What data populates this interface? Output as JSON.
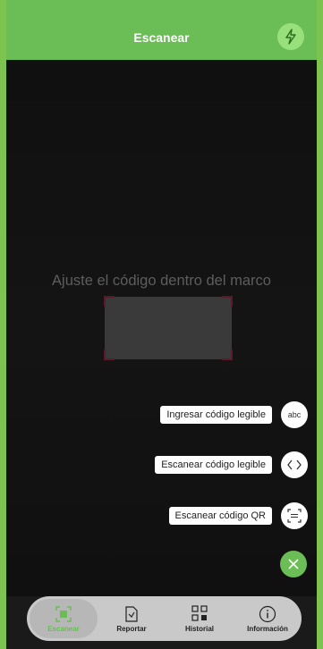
{
  "header": {
    "title": "Escanear",
    "flash_icon": "flash-icon"
  },
  "camera": {
    "hint": "Ajuste el código dentro del marco"
  },
  "actions": [
    {
      "label": "Ingresar código legible",
      "icon": "abc",
      "icon_name": "text-input-icon"
    },
    {
      "label": "Escanear código legible",
      "icon": "<>",
      "icon_name": "code-brackets-icon"
    },
    {
      "label": "Escanear código QR",
      "icon": "qr",
      "icon_name": "barcode-scan-icon"
    }
  ],
  "navbar": {
    "items": [
      {
        "label": "Escanear",
        "icon_name": "scan-icon",
        "active": true
      },
      {
        "label": "Reportar",
        "icon_name": "report-icon",
        "active": false
      },
      {
        "label": "Historial",
        "icon_name": "history-qr-icon",
        "active": false
      },
      {
        "label": "Información",
        "icon_name": "info-icon",
        "active": false
      }
    ]
  },
  "colors": {
    "accent": "#6bbd55",
    "border": "#7dc34f"
  }
}
